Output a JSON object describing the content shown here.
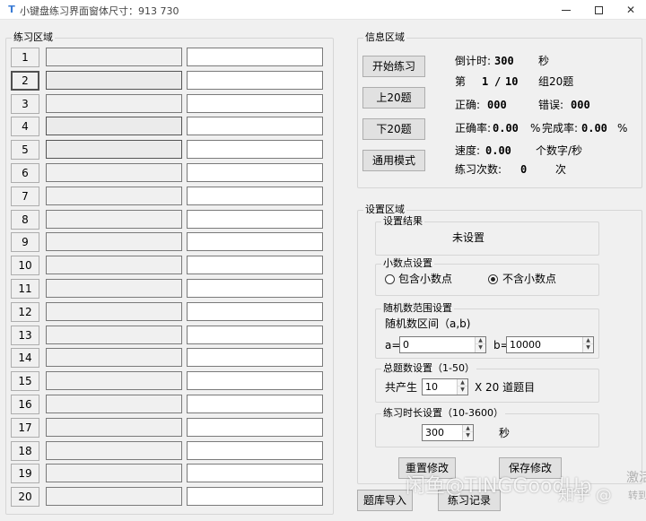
{
  "window": {
    "title": "小键盘练习界面窗体尺寸：913 730",
    "icon_glyph": "T",
    "minimize_label": "",
    "maximize_label": "",
    "close_label": "✕"
  },
  "practice": {
    "title": "练习区域",
    "rows": [
      {
        "num": "1"
      },
      {
        "num": "2"
      },
      {
        "num": "3"
      },
      {
        "num": "4"
      },
      {
        "num": "5"
      },
      {
        "num": "6"
      },
      {
        "num": "7"
      },
      {
        "num": "8"
      },
      {
        "num": "9"
      },
      {
        "num": "10"
      },
      {
        "num": "11"
      },
      {
        "num": "12"
      },
      {
        "num": "13"
      },
      {
        "num": "14"
      },
      {
        "num": "15"
      },
      {
        "num": "16"
      },
      {
        "num": "17"
      },
      {
        "num": "18"
      },
      {
        "num": "19"
      },
      {
        "num": "20"
      }
    ]
  },
  "info": {
    "title": "信息区域",
    "btn_start": "开始练习",
    "btn_prev": "上20题",
    "btn_next": "下20题",
    "btn_mode": "通用模式",
    "countdown_label": "倒计时:",
    "countdown_value": "300",
    "countdown_unit": "秒",
    "page_prefix": "第",
    "page_current": "1",
    "page_sep": "/",
    "page_total": "10",
    "page_suffix": "组20题",
    "correct_label": "正确:",
    "correct_value": "000",
    "wrong_label": "错误:",
    "wrong_value": "000",
    "accuracy_label": "正确率:",
    "accuracy_value": "0.00",
    "accuracy_unit": "%",
    "completion_label": "完成率:",
    "completion_value": "0.00",
    "completion_unit": "%",
    "speed_label": "速度:",
    "speed_value": "0.00",
    "speed_unit": "个数字/秒",
    "times_label": "练习次数:",
    "times_value": "0",
    "times_unit": "次"
  },
  "settings": {
    "title": "设置区域",
    "result_title": "设置结果",
    "result_value": "未设置",
    "decimal_title": "小数点设置",
    "decimal_opt1": "包含小数点",
    "decimal_opt2": "不含小数点",
    "decimal_selected": "不含小数点",
    "range_title": "随机数范围设置",
    "range_interval": "随机数区间（a,b)",
    "a_label": "a=",
    "a_value": "0",
    "b_label": "b=",
    "b_value": "10000",
    "total_title": "总题数设置（1-50）",
    "total_prefix": "共产生",
    "total_value": "10",
    "total_suffix": "X 20 道题目",
    "duration_title": "练习时长设置（10-3600）",
    "duration_value": "300",
    "duration_unit": "秒",
    "btn_reset": "重置修改",
    "btn_save": "保存修改"
  },
  "footer": {
    "btn_import": "题库导入",
    "btn_record": "练习记录"
  },
  "watermark": {
    "text1": "闲鱼@TINGGoodUp",
    "text2": "知乎 @",
    "text3": "激活",
    "text4": "转到"
  }
}
